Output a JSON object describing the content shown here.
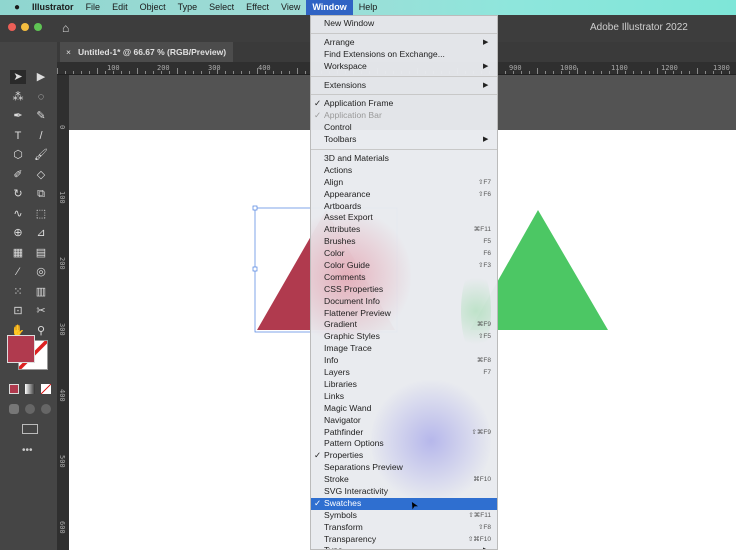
{
  "menubar": {
    "apple": "",
    "app": "Illustrator",
    "items": [
      "File",
      "Edit",
      "Object",
      "Type",
      "Select",
      "Effect",
      "View",
      "Window",
      "Help"
    ]
  },
  "titlebar": {
    "title": "Adobe Illustrator 2022"
  },
  "tab": {
    "close": "×",
    "title": "Untitled-1* @ 66.67 % (RGB/Preview)"
  },
  "ruler": {
    "h": [
      "100",
      "200",
      "300",
      "400",
      "900",
      "1000",
      "1100",
      "1200",
      "1300"
    ],
    "v": [
      "0",
      "100",
      "200",
      "300",
      "400",
      "500",
      "600"
    ]
  },
  "colors": {
    "fill": "#b03a4e",
    "red_triangle": "#b03a4e",
    "green_triangle": "#4cc764",
    "highlight": "#2f6fd0"
  },
  "window_menu": {
    "groups": [
      [
        {
          "label": "New Window"
        }
      ],
      [
        {
          "label": "Arrange",
          "submenu": true
        },
        {
          "label": "Find Extensions on Exchange..."
        },
        {
          "label": "Workspace",
          "submenu": true
        }
      ],
      [
        {
          "label": "Extensions",
          "submenu": true
        }
      ],
      [
        {
          "label": "Application Frame",
          "checked": true
        },
        {
          "label": "Application Bar",
          "checked": true,
          "disabled": true
        },
        {
          "label": "Control"
        },
        {
          "label": "Toolbars",
          "submenu": true
        }
      ],
      [
        {
          "label": "3D and Materials"
        },
        {
          "label": "Actions"
        },
        {
          "label": "Align",
          "shortcut": "⇧F7"
        },
        {
          "label": "Appearance",
          "shortcut": "⇧F6"
        },
        {
          "label": "Artboards"
        },
        {
          "label": "Asset Export"
        },
        {
          "label": "Attributes",
          "shortcut": "⌘F11"
        },
        {
          "label": "Brushes",
          "shortcut": "F5"
        },
        {
          "label": "Color",
          "shortcut": "F6"
        },
        {
          "label": "Color Guide",
          "shortcut": "⇧F3"
        },
        {
          "label": "Comments"
        },
        {
          "label": "CSS Properties"
        },
        {
          "label": "Document Info"
        },
        {
          "label": "Flattener Preview"
        },
        {
          "label": "Gradient",
          "shortcut": "⌘F9"
        },
        {
          "label": "Graphic Styles",
          "shortcut": "⇧F5"
        },
        {
          "label": "Image Trace"
        },
        {
          "label": "Info",
          "shortcut": "⌘F8"
        },
        {
          "label": "Layers",
          "shortcut": "F7"
        },
        {
          "label": "Libraries"
        },
        {
          "label": "Links"
        },
        {
          "label": "Magic Wand"
        },
        {
          "label": "Navigator"
        },
        {
          "label": "Pathfinder",
          "shortcut": "⇧⌘F9"
        },
        {
          "label": "Pattern Options"
        },
        {
          "label": "Properties",
          "checked": true
        },
        {
          "label": "Separations Preview"
        },
        {
          "label": "Stroke",
          "shortcut": "⌘F10"
        },
        {
          "label": "SVG Interactivity"
        },
        {
          "label": "Swatches",
          "checked": true,
          "highlighted": true
        },
        {
          "label": "Symbols",
          "shortcut": "⇧⌘F11"
        },
        {
          "label": "Transform",
          "shortcut": "⇧F8"
        },
        {
          "label": "Transparency",
          "shortcut": "⇧⌘F10"
        },
        {
          "label": "Type",
          "submenu": true
        }
      ]
    ]
  }
}
